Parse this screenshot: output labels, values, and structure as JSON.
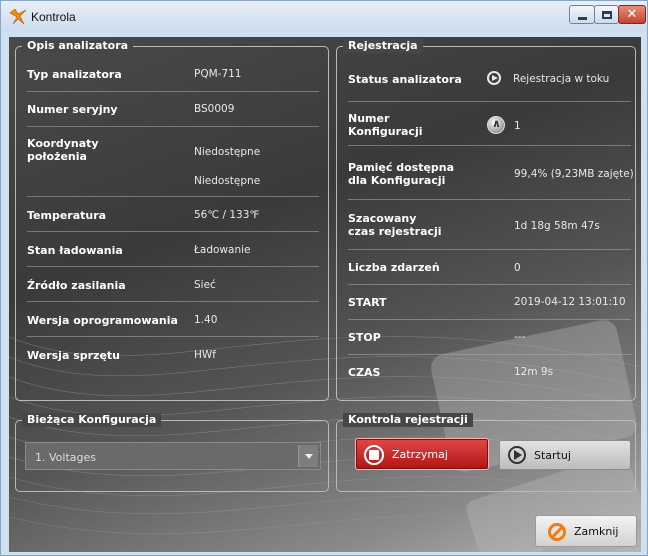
{
  "window": {
    "title": "Kontrola",
    "close_symbol": "✕"
  },
  "icons": {
    "app": "app-logo-icon",
    "minimize": "minimize-icon",
    "maximize": "maximize-icon",
    "close": "close-icon",
    "status": "play-circle-icon",
    "config": "configuration-icon",
    "stop": "stop-icon",
    "start": "play-icon",
    "zamknij": "cancel-icon"
  },
  "colors": {
    "stop_button": "#c41e1e",
    "close_icon_accent": "#f07c12",
    "panel_bg": "#464646"
  },
  "opis": {
    "legend": "Opis analizatora",
    "rows": [
      {
        "label": "Typ analizatora",
        "value": "PQM-711"
      },
      {
        "label": "Numer seryjny",
        "value": "BS0009"
      },
      {
        "label": "Koordynaty położenia",
        "value": "Niedostępne",
        "value2": "Niedostępne"
      },
      {
        "label": "Temperatura",
        "value": "56℃ / 133℉"
      },
      {
        "label": "Stan ładowania",
        "value": "Ładowanie"
      },
      {
        "label": "Źródło zasilania",
        "value": "Sieć"
      },
      {
        "label": "Wersja oprogramowania",
        "value": "1.40"
      },
      {
        "label": "Wersja sprzętu",
        "value": "HWf"
      }
    ]
  },
  "rejestracja": {
    "legend": "Rejestracja",
    "rows": [
      {
        "label": "Status analizatora",
        "value": "Rejestracja w toku"
      },
      {
        "label": "Numer\nKonfiguracji",
        "value": "1"
      },
      {
        "label": "Pamięć dostępna\ndla Konfiguracji",
        "value": "99,4% (9,23MB zajęte)"
      },
      {
        "label": "Szacowany\nczas rejestracji",
        "value": "1d 18g 58m 47s"
      },
      {
        "label": "Liczba zdarzeń",
        "value": "0"
      },
      {
        "label": "START",
        "value": "2019-04-12 13:01:10"
      },
      {
        "label": "STOP",
        "value": "---"
      },
      {
        "label": "CZAS",
        "value": "12m 9s"
      }
    ]
  },
  "biezaca": {
    "legend": "Bieżąca Konfiguracja",
    "selected": "1. Voltages"
  },
  "kontrola": {
    "legend": "Kontrola rejestracji",
    "stop_label": "Zatrzymaj",
    "start_label": "Startuj"
  },
  "footer": {
    "close_label": "Zamknij"
  }
}
